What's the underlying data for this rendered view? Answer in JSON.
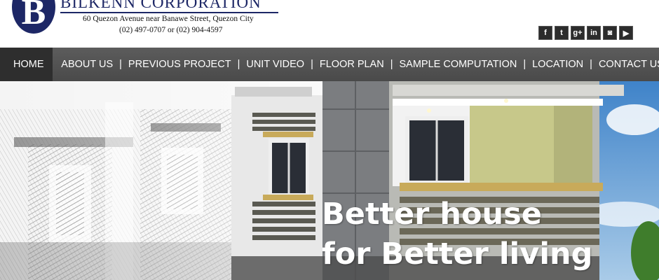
{
  "header": {
    "logo_letter": "B",
    "company_name": "BILKENN CORPORATION",
    "address": "60 Quezon Avenue near Banawe Street, Quezon City",
    "phone": "(02) 497-0707 or (02) 904-4597"
  },
  "social": [
    {
      "icon": "facebook-icon",
      "glyph": "f"
    },
    {
      "icon": "twitter-icon",
      "glyph": "t"
    },
    {
      "icon": "google-plus-icon",
      "glyph": "g+"
    },
    {
      "icon": "linkedin-icon",
      "glyph": "in"
    },
    {
      "icon": "instagram-icon",
      "glyph": "◙"
    },
    {
      "icon": "youtube-icon",
      "glyph": "▶"
    }
  ],
  "nav": {
    "items": [
      "HOME",
      "ABOUT US",
      "PREVIOUS PROJECT",
      "UNIT VIDEO",
      "FLOOR PLAN",
      "SAMPLE COMPUTATION",
      "LOCATION",
      "CONTACT US"
    ],
    "separator": "|",
    "active": "HOME"
  },
  "hero": {
    "line1": "Better house",
    "line2": "for Better living"
  },
  "colors": {
    "brand": "#1d2766",
    "nav_bg": "#545454",
    "nav_active": "#2e2e2e"
  }
}
